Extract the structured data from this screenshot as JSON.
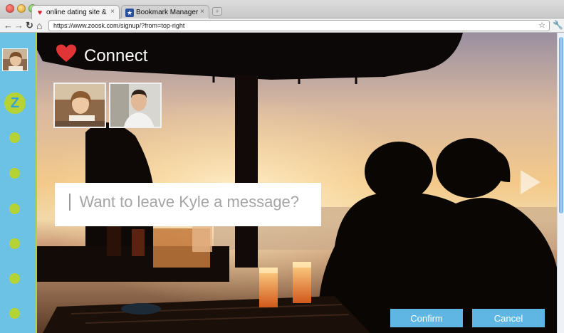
{
  "browser": {
    "tabs": [
      {
        "label": "online dating site &",
        "icon": "heart-favicon-icon",
        "active": true
      },
      {
        "label": "Bookmark Manager",
        "icon": "bookmark-star-favicon-icon",
        "active": false
      }
    ],
    "close_glyph": "×",
    "new_tab_glyph": "+",
    "url": "https://www.zoosk.com/signup/?from=top-right",
    "nav_icons": {
      "back": "←",
      "forward": "→",
      "reload": "↻",
      "home": "⌂",
      "star": "☆",
      "wrench": "🔧"
    }
  },
  "sidebar": {
    "logo_letter": "Z",
    "dot_count": 6
  },
  "header": {
    "title": "Connect"
  },
  "message": {
    "placeholder": "Want to leave Kyle a message?"
  },
  "actions": {
    "confirm_label": "Confirm",
    "cancel_label": "Cancel"
  },
  "colors": {
    "sidebar_bg": "#6cc2e4",
    "accent_green": "#b5d334",
    "button_blue": "#60b6e3",
    "heart_red": "#d8262f"
  }
}
